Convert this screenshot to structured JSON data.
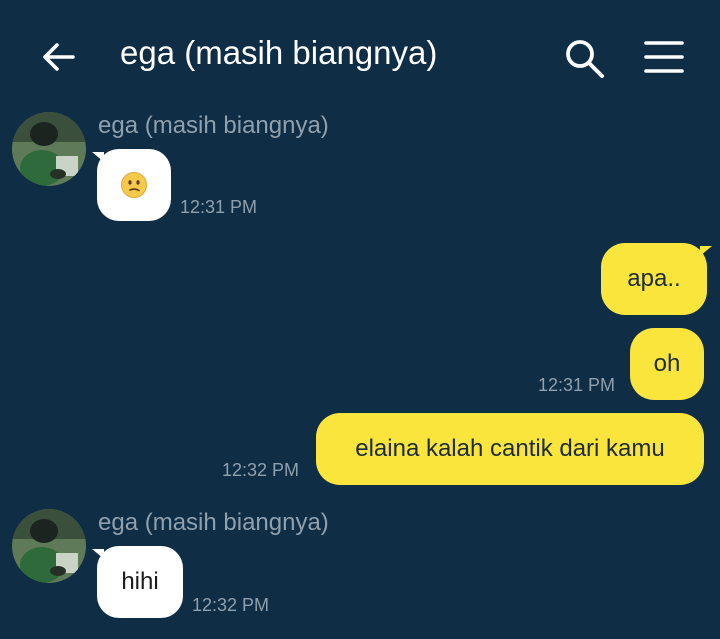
{
  "header": {
    "title": "ega (masih biangnya)",
    "back_icon": "arrow-left-icon",
    "search_icon": "search-icon",
    "menu_icon": "hamburger-menu-icon"
  },
  "messages": [
    {
      "direction": "in",
      "sender": "ega (masih biangnya)",
      "content": "🫤",
      "content_type": "emoji",
      "time": "12:31 PM"
    },
    {
      "direction": "out",
      "content": "apa..",
      "time": ""
    },
    {
      "direction": "out",
      "content": "oh",
      "time": "12:31 PM"
    },
    {
      "direction": "out",
      "content": "elaina kalah cantik dari kamu",
      "time": "12:32 PM"
    },
    {
      "direction": "in",
      "sender": "ega (masih biangnya)",
      "content": "hihi",
      "time": "12:32 PM"
    }
  ],
  "colors": {
    "background": "#0f2d44",
    "outgoing_bubble": "#f9e53b",
    "incoming_bubble": "#ffffff",
    "meta_text": "#8fa0ae"
  }
}
